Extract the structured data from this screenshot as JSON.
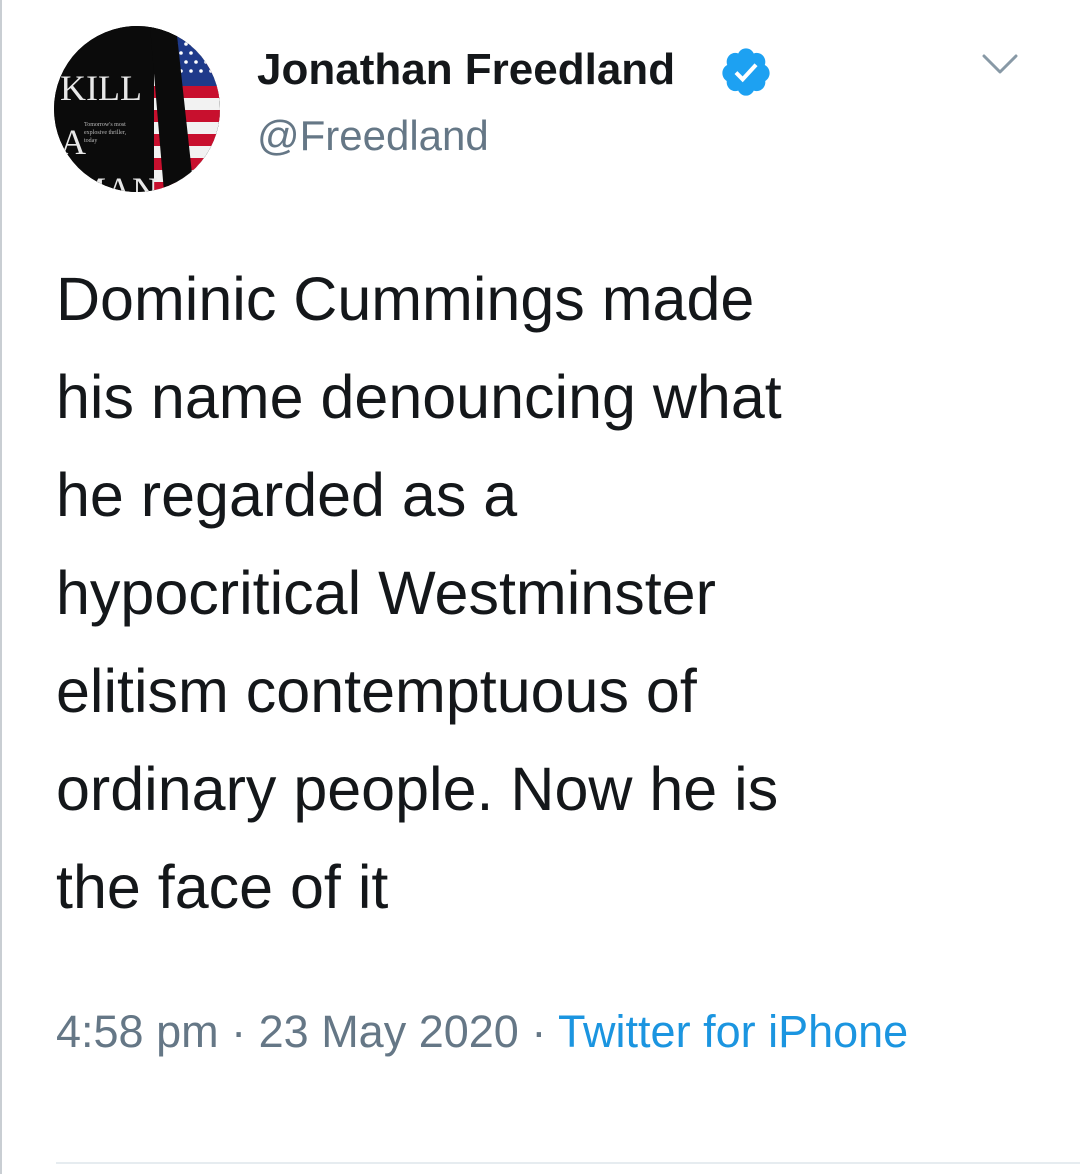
{
  "tweet": {
    "author": {
      "display_name": "Jonathan Freedland",
      "handle": "@Freedland",
      "verified": true,
      "avatar": {
        "icon": "book-cover-avatar",
        "cover_text": [
          "KILL",
          "A",
          "MAN"
        ],
        "tagline": "Tomorrow's most explosive thriller, today"
      }
    },
    "text_lines": [
      "Dominic Cummings made",
      "his name denouncing what",
      "he regarded as a",
      "hypocritical Westminster",
      "elitism contemptuous of",
      "ordinary people. Now he is",
      "the face of it"
    ],
    "time": "4:58 pm",
    "separator": "·",
    "date": "23 May 2020",
    "source": "Twitter for iPhone",
    "menu_icon": "chevron-down-icon"
  },
  "colors": {
    "text": "#14171a",
    "secondary": "#657786",
    "link": "#1b95e0",
    "verified_badge": "#1da1f2"
  }
}
